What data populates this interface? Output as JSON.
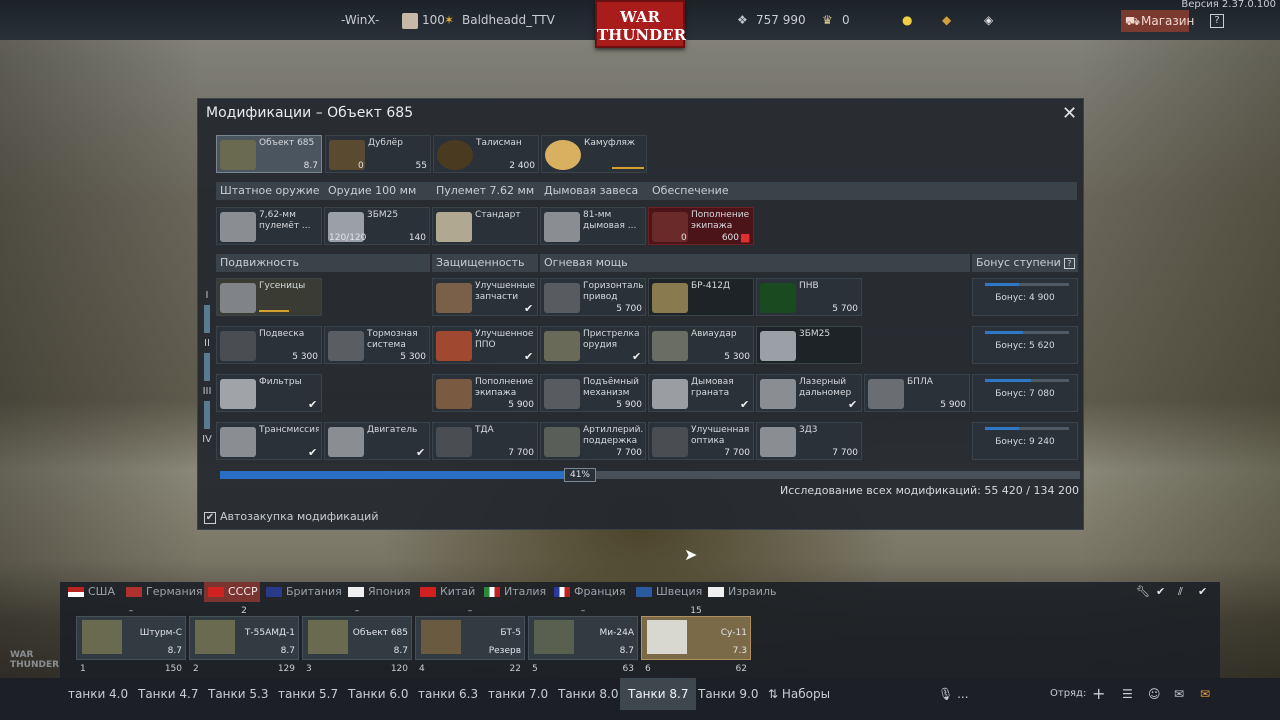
{
  "version": "Версия 2.37.0.100",
  "top": {
    "squad": "-WinX-",
    "player_level": "100",
    "player_name": "Baldheadd_TTV",
    "silver_lions": "757 990",
    "eagles": "0",
    "logo_line1": "WAR",
    "logo_line2": "THUNDER",
    "shop": "Магазин",
    "help": "?"
  },
  "dialog": {
    "title": "Модификации – Объект 685",
    "vehicle_cards": [
      {
        "name": "Объект 685",
        "price": "8.7"
      },
      {
        "name": "Дублёр",
        "left": "0",
        "price": "55"
      },
      {
        "name": "Талисман",
        "price": "2 400"
      },
      {
        "name": "Камуфляж",
        "price": ""
      }
    ],
    "weapon_headers": [
      "Штатное оружие",
      "Орудие 100 мм",
      "Пулемет 7.62 мм",
      "Дымовая завеса",
      "Обеспечение"
    ],
    "weapon_cards": [
      {
        "name": "7,62-мм пулемёт ...",
        "left": "",
        "price": ""
      },
      {
        "name": "3БМ25",
        "left": "120/120",
        "price": "140"
      },
      {
        "name": "Стандарт",
        "left": "",
        "price": ""
      },
      {
        "name": "81-мм дымовая ...",
        "left": "",
        "price": ""
      },
      {
        "name": "Пополнение экипажа",
        "left": "0",
        "price": "600"
      }
    ],
    "sections": [
      "Подвижность",
      "Защищенность",
      "Огневая мощь",
      "Бонус ступени"
    ],
    "tiers": [
      "I",
      "II",
      "III",
      "IV"
    ],
    "mods": [
      {
        "name": "Гусеницы",
        "price": ""
      },
      {
        "name": "Улучшенные запчасти",
        "price": ""
      },
      {
        "name": "Горизонталь... привод",
        "price": "5 700"
      },
      {
        "name": "БР-412Д",
        "price": ""
      },
      {
        "name": "ПНВ",
        "price": "5 700"
      },
      {
        "name": "Подвеска",
        "price": "5 300"
      },
      {
        "name": "Тормозная система",
        "price": "5 300"
      },
      {
        "name": "Улучшенное ППО",
        "price": ""
      },
      {
        "name": "Пристрелка орудия",
        "price": ""
      },
      {
        "name": "Авиаудар",
        "price": "5 300"
      },
      {
        "name": "3БМ25",
        "price": ""
      },
      {
        "name": "Фильтры",
        "price": ""
      },
      {
        "name": "Пополнение экипажа",
        "price": "5 900"
      },
      {
        "name": "Подъёмный механизм",
        "price": "5 900"
      },
      {
        "name": "Дымовая граната",
        "price": ""
      },
      {
        "name": "Лазерный дальномер",
        "price": ""
      },
      {
        "name": "БПЛА",
        "price": "5 900"
      },
      {
        "name": "Трансмиссия",
        "price": ""
      },
      {
        "name": "Двигатель",
        "price": ""
      },
      {
        "name": "ТДА",
        "price": "7 700"
      },
      {
        "name": "Артиллерий... поддержка",
        "price": "7 700"
      },
      {
        "name": "Улучшенная оптика",
        "price": "7 700"
      },
      {
        "name": "3Д3",
        "price": "7 700"
      }
    ],
    "bonuses": [
      "Бонус: 4 900",
      "Бонус: 5 620",
      "Бонус: 7 080",
      "Бонус: 9 240"
    ],
    "bonus_fill": [
      0.4,
      0.45,
      0.55,
      0.4
    ],
    "progress": {
      "label": "41%",
      "value": 0.41
    },
    "research": "Исследование всех модификаций: 55 420 / 134 200",
    "auto_buy": "Автозакупка модификаций",
    "close_icon": "close-icon"
  },
  "nations": [
    "США",
    "Германия",
    "СССР",
    "Британия",
    "Япония",
    "Китай",
    "Италия",
    "Франция",
    "Швеция",
    "Израиль"
  ],
  "vehicles": [
    {
      "top": "–",
      "name": "Штурм-С",
      "rank": "8.7",
      "num": "1",
      "cost": "150"
    },
    {
      "top": "2",
      "name": "Т-55АМД-1",
      "rank": "8.7",
      "num": "2",
      "cost": "129"
    },
    {
      "top": "–",
      "name": "Объект 685",
      "rank": "8.7",
      "num": "3",
      "cost": "120"
    },
    {
      "top": "–",
      "name": "БТ-5",
      "rank": "Резерв",
      "num": "4",
      "cost": "22"
    },
    {
      "top": "–",
      "name": "Ми-24А",
      "rank": "8.7",
      "num": "5",
      "cost": "63"
    },
    {
      "top": "15",
      "name": "Су-11",
      "rank": "7.3",
      "num": "6",
      "cost": "62"
    }
  ],
  "tabs": [
    "танки 4.0",
    "Танки 4.7",
    "Танки 5.3",
    "танки 5.7",
    "Танки 6.0",
    "танки 6.3",
    "танки 7.0",
    "Танки 8.0",
    "Танки 8.7",
    "Танки 9.0",
    "Наборы"
  ],
  "bottom": {
    "mic": "...",
    "squad": "Отряд:"
  },
  "colors": {
    "accent": "#2a6fc4",
    "selected_nation": "#7a3432",
    "logo": "#a91c1c"
  }
}
